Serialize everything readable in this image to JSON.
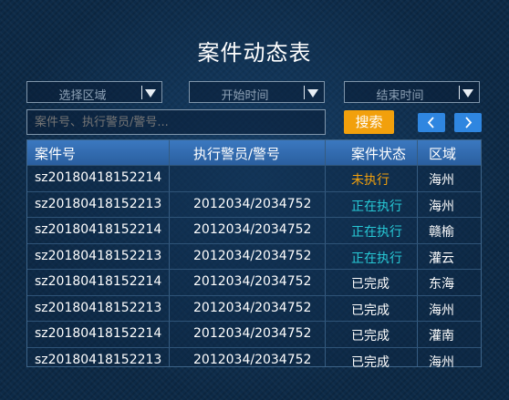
{
  "title": "案件动态表",
  "filters": {
    "region_placeholder": "选择区域",
    "start_time_placeholder": "开始时间",
    "end_time_placeholder": "结束时间"
  },
  "search": {
    "placeholder": "案件号、执行警员/警号...",
    "button_label": "搜索"
  },
  "colors": {
    "pending": "#f2a00c",
    "executing": "#27c9d6",
    "done": "#ffffff",
    "accent_blue": "#2f86e0"
  },
  "table": {
    "columns": [
      "案件号",
      "执行警员/警号",
      "案件状态",
      "区域"
    ],
    "rows": [
      {
        "case_no": "sz20180418152214",
        "officer": "",
        "status": "未执行",
        "status_key": "pending",
        "region": "海州"
      },
      {
        "case_no": "sz20180418152213",
        "officer": "2012034/2034752",
        "status": "正在执行",
        "status_key": "executing",
        "region": "海州"
      },
      {
        "case_no": "sz20180418152214",
        "officer": "2012034/2034752",
        "status": "正在执行",
        "status_key": "executing",
        "region": "赣榆"
      },
      {
        "case_no": "sz20180418152213",
        "officer": "2012034/2034752",
        "status": "正在执行",
        "status_key": "executing",
        "region": "灌云"
      },
      {
        "case_no": "sz20180418152214",
        "officer": "2012034/2034752",
        "status": "已完成",
        "status_key": "done",
        "region": "东海"
      },
      {
        "case_no": "sz20180418152213",
        "officer": "2012034/2034752",
        "status": "已完成",
        "status_key": "done",
        "region": "海州"
      },
      {
        "case_no": "sz20180418152214",
        "officer": "2012034/2034752",
        "status": "已完成",
        "status_key": "done",
        "region": "灌南"
      },
      {
        "case_no": "sz20180418152213",
        "officer": "2012034/2034752",
        "status": "已完成",
        "status_key": "done",
        "region": "海州"
      }
    ]
  },
  "icons": {
    "prev": "chevron-left-icon",
    "next": "chevron-right-icon",
    "dropdown": "triangle-down-icon"
  }
}
